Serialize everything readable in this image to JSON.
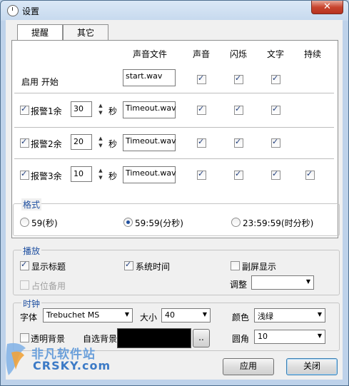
{
  "window": {
    "title": "设置",
    "close_glyph": "✕"
  },
  "tabs": [
    {
      "label": "提醒",
      "active": true
    },
    {
      "label": "其它",
      "active": false
    }
  ],
  "alarm_table": {
    "headers": {
      "sound_file": "声音文件",
      "sound": "声音",
      "flash": "闪烁",
      "text": "文字",
      "continuous": "持续"
    },
    "rows": [
      {
        "label": "启用 开始",
        "has_checkbox": false,
        "file": "start.wav",
        "sound": true,
        "flash": true,
        "text": true,
        "continuous": false
      },
      {
        "label": "报警1余",
        "has_checkbox": true,
        "checked": true,
        "value": "30",
        "unit": "秒",
        "file": "Timeout.wav",
        "sound": true,
        "flash": true,
        "text": true,
        "continuous": false
      },
      {
        "label": "报警2余",
        "has_checkbox": true,
        "checked": true,
        "value": "20",
        "unit": "秒",
        "file": "Timeout.wav",
        "sound": true,
        "flash": true,
        "text": true,
        "continuous": false
      },
      {
        "label": "报警3余",
        "has_checkbox": true,
        "checked": true,
        "value": "10",
        "unit": "秒",
        "file": "Timeout.wav",
        "sound": true,
        "flash": true,
        "text": true,
        "continuous": true
      }
    ]
  },
  "format_group": {
    "title": "格式",
    "options": [
      {
        "label": "59(秒)",
        "selected": false
      },
      {
        "label": "59:59(分秒)",
        "selected": true
      },
      {
        "label": "23:59:59(时分秒)",
        "selected": false
      }
    ]
  },
  "play_group": {
    "title": "播放",
    "show_title": {
      "label": "显示标题",
      "checked": true
    },
    "system_time": {
      "label": "系统时间",
      "checked": true
    },
    "secondary_display": {
      "label": "副屏显示",
      "checked": false
    },
    "placeholder": {
      "label": "占位备用",
      "checked": false,
      "disabled": true
    },
    "adjust_label": "调整",
    "adjust_value": ""
  },
  "clock_group": {
    "title": "时钟",
    "font_label": "字体",
    "font_value": "Trebuchet MS",
    "size_label": "大小",
    "size_value": "40",
    "color_label": "颜色",
    "color_value": "浅绿",
    "transparent": {
      "label": "透明背景",
      "checked": false
    },
    "custom_bg_label": "自选背景",
    "browse_label": "..",
    "radius_label": "圆角",
    "radius_value": "10"
  },
  "buttons": {
    "apply": "应用",
    "close": "关闭"
  },
  "watermark": {
    "title": "非凡软件站",
    "subtitle": "CRSKY.com"
  },
  "colors": {
    "accent": "#1e4fa0",
    "close_button": "#c8452f"
  }
}
